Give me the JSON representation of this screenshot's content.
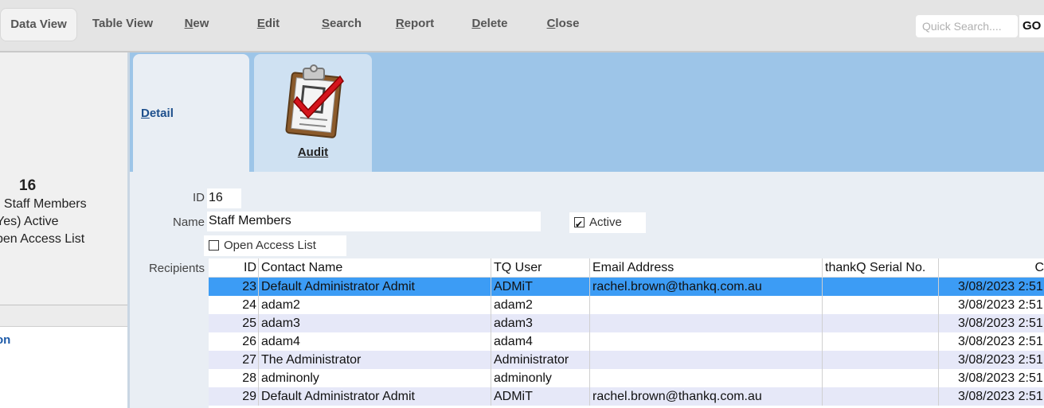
{
  "toolbar": {
    "buttons": [
      {
        "label": "Data View"
      },
      {
        "label": "Table View"
      },
      {
        "key": "N",
        "rest": "ew"
      },
      {
        "key": "E",
        "rest": "dit"
      },
      {
        "key": "S",
        "rest": "earch"
      },
      {
        "key": "R",
        "rest": "eport"
      },
      {
        "key": "D",
        "rest": "elete"
      },
      {
        "key": "C",
        "rest": "lose"
      }
    ],
    "quick_search_placeholder": "Quick Search....",
    "go_label": "GO"
  },
  "left_panel": {
    "id": "16",
    "line1": ": Staff Members",
    "line2": "Yes) Active",
    "line3": "pen Access List",
    "link": "on"
  },
  "tabs": {
    "detail_key": "D",
    "detail_rest": "etail",
    "audit_key": "A",
    "audit_rest": "udit",
    "audit_icon": "clipboard-check-icon"
  },
  "form": {
    "id_label": "ID",
    "id_value": "16",
    "name_label": "Name",
    "name_value": "Staff Members",
    "active_label": "Active",
    "active_checked": true,
    "open_access_label": "Open Access List",
    "open_access_checked": false,
    "recipients_label": "Recipients"
  },
  "grid": {
    "columns": [
      "ID",
      "Contact Name",
      "TQ User",
      "Email Address",
      "thankQ Serial No.",
      "C"
    ],
    "rows": [
      {
        "id": "23",
        "name": "Default Administrator Admit",
        "user": "ADMiT",
        "email": "rachel.brown@thankq.com.au",
        "serial": "",
        "created": "3/08/2023 2:51"
      },
      {
        "id": "24",
        "name": "adam2",
        "user": "adam2",
        "email": "",
        "serial": "",
        "created": "3/08/2023 2:51"
      },
      {
        "id": "25",
        "name": "adam3",
        "user": "adam3",
        "email": "",
        "serial": "",
        "created": "3/08/2023 2:51"
      },
      {
        "id": "26",
        "name": "adam4",
        "user": "adam4",
        "email": "",
        "serial": "",
        "created": "3/08/2023 2:51"
      },
      {
        "id": "27",
        "name": "The Administrator",
        "user": "Administrator",
        "email": "",
        "serial": "",
        "created": "3/08/2023 2:51"
      },
      {
        "id": "28",
        "name": "adminonly",
        "user": "adminonly",
        "email": "",
        "serial": "",
        "created": "3/08/2023 2:51"
      },
      {
        "id": "29",
        "name": "Default Administrator Admit",
        "user": "ADMiT",
        "email": "rachel.brown@thankq.com.au",
        "serial": "",
        "created": "3/08/2023 2:51"
      }
    ]
  }
}
